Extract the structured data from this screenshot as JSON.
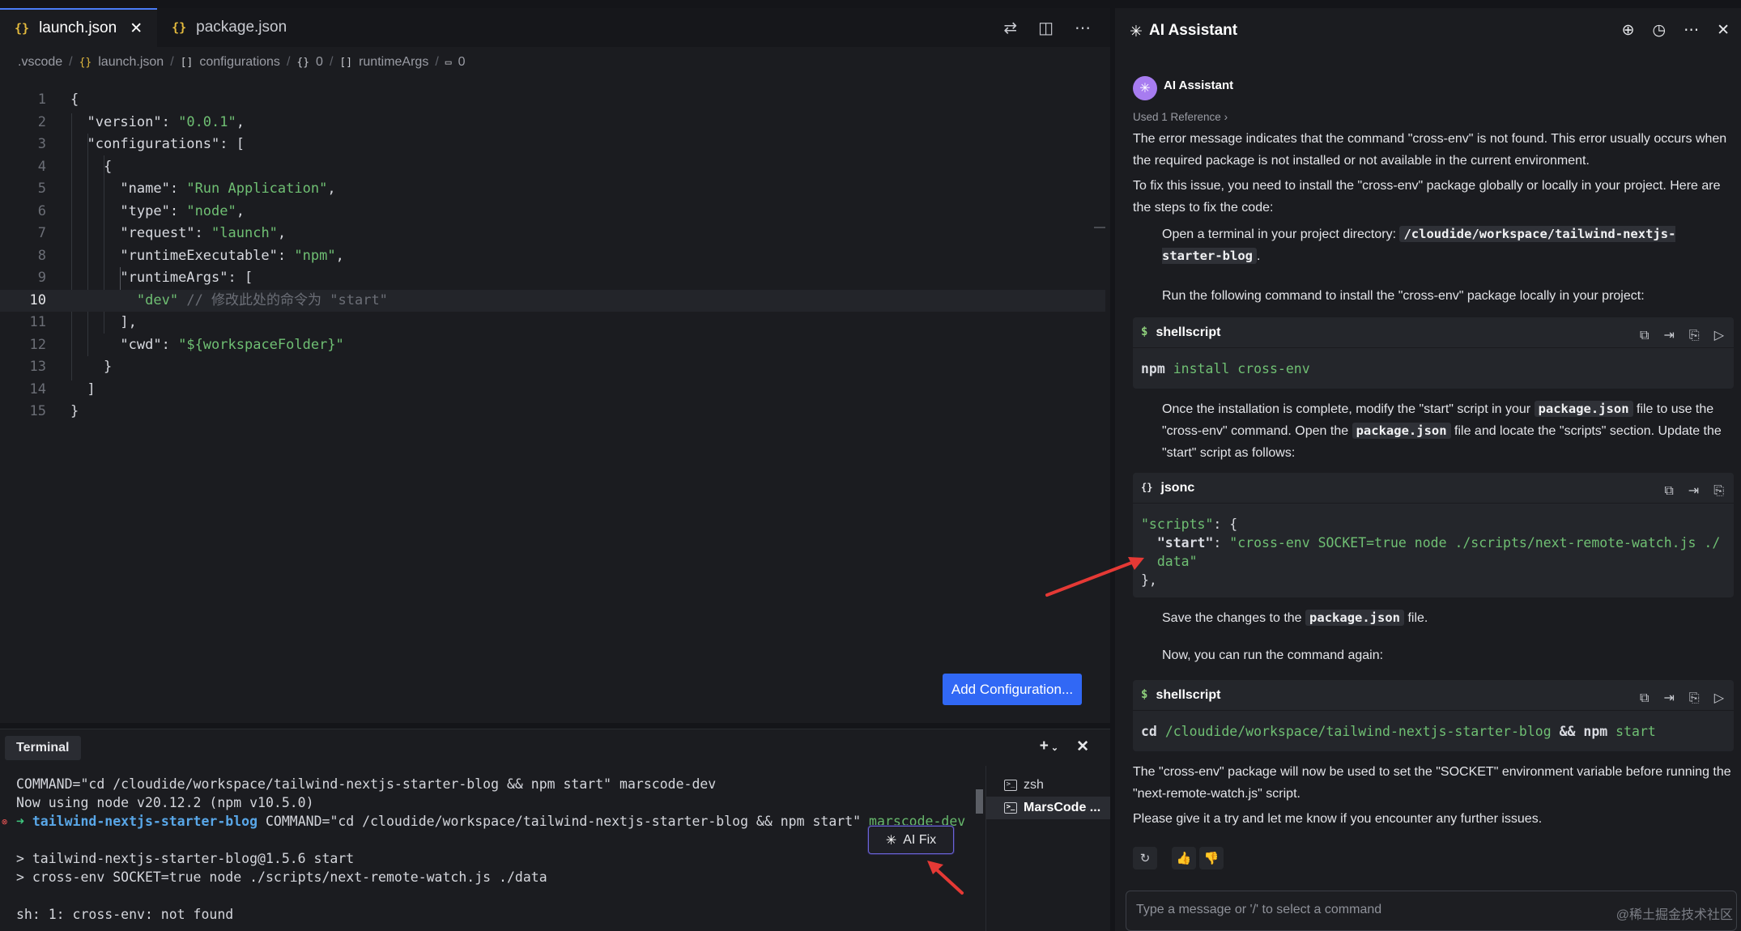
{
  "editor": {
    "tabs": [
      {
        "label": "launch.json",
        "active": true
      },
      {
        "label": "package.json",
        "active": false
      }
    ],
    "breadcrumb": [
      ".vscode",
      "launch.json",
      "configurations",
      "0",
      "runtimeArgs",
      "0"
    ],
    "lines": [
      {
        "n": "1"
      },
      {
        "n": "2"
      },
      {
        "n": "3"
      },
      {
        "n": "4"
      },
      {
        "n": "5"
      },
      {
        "n": "6"
      },
      {
        "n": "7"
      },
      {
        "n": "8"
      },
      {
        "n": "9"
      },
      {
        "n": "10"
      },
      {
        "n": "11"
      },
      {
        "n": "12"
      },
      {
        "n": "13"
      },
      {
        "n": "14"
      },
      {
        "n": "15"
      }
    ],
    "code": {
      "l1": "{",
      "l2_key": "\"version\"",
      "l2_val": "\"0.0.1\"",
      "l3_key": "\"configurations\"",
      "l3_rest": ": [",
      "l4": "{",
      "l5_key": "\"name\"",
      "l5_val": "\"Run Application\"",
      "l6_key": "\"type\"",
      "l6_val": "\"node\"",
      "l7_key": "\"request\"",
      "l7_val": "\"launch\"",
      "l8_key": "\"runtimeExecutable\"",
      "l8_val": "\"npm\"",
      "l9_key": "\"runtimeArgs\"",
      "l9_rest": ": [",
      "l10_val": "\"dev\"",
      "l10_comment": "// 修改此处的命令为 \"start\"",
      "l11": "],",
      "l12_key": "\"cwd\"",
      "l12_val": "\"${workspaceFolder}\"",
      "l13": "}",
      "l14": "]",
      "l15": "}"
    },
    "add_config_label": "Add Configuration..."
  },
  "terminal": {
    "tab_label": "Terminal",
    "line1": "COMMAND=\"cd /cloudide/workspace/tailwind-nextjs-starter-blog && npm start\" marscode-dev",
    "line2": "Now using node v20.12.2 (npm v10.5.0)",
    "line3_arrow": "➜",
    "line3_dir": "tailwind-nextjs-starter-blog",
    "line3_cmd": "COMMAND=\"cd /cloudide/workspace/tailwind-nextjs-starter-blog && npm start\"",
    "line3_host": "marscode-dev",
    "line4": "> tailwind-nextjs-starter-blog@1.5.6 start",
    "line5": "> cross-env SOCKET=true node ./scripts/next-remote-watch.js ./data",
    "line6": "sh: 1: cross-env: not found",
    "ai_fix_label": "AI Fix",
    "sessions": [
      {
        "label": "zsh",
        "selected": false
      },
      {
        "label": "MarsCode ...",
        "selected": true
      }
    ]
  },
  "assistant": {
    "title": "AI Assistant",
    "sender": "AI Assistant",
    "reference": "Used 1 Reference",
    "p1": "The error message indicates that the command \"cross-env\" is not found. This error usually occurs when the required package is not installed or not available in the current environment.",
    "p2": "To fix this issue, you need to install the \"cross-env\" package globally or locally in your project. Here are the steps to fix the code:",
    "step1_text": "Open a terminal in your project directory:",
    "step1_code": "/cloudide/workspace/tailwind-nextjs-starter-blog",
    "step2_text": "Run the following command to install the \"cross-env\" package locally in your project:",
    "block1": {
      "lang": "shellscript",
      "code_kw": "npm",
      "code_rest": "install cross-env"
    },
    "step3_a": "Once the installation is complete, modify the \"start\" script in your",
    "step3_code1": "package.json",
    "step3_b": "file to use the \"cross-env\" command. Open the",
    "step3_code2": "package.json",
    "step3_c": "file and locate the \"scripts\" section. Update the \"start\" script as follows:",
    "block2": {
      "lang": "jsonc",
      "l1_key": "\"scripts\"",
      "l1_rest": ": {",
      "l2_key": "\"start\"",
      "l2_val": "\"cross-env SOCKET=true node ./scripts/next-remote-watch.js ./",
      "l3_val": "data\"",
      "l4": "},"
    },
    "step4_a": "Save the changes to the",
    "step4_code": "package.json",
    "step4_b": "file.",
    "step5": "Now, you can run the command again:",
    "block3": {
      "lang": "shellscript",
      "code_kw1": "cd",
      "code_path": "/cloudide/workspace/tailwind-nextjs-starter-blog",
      "code_amp": "&&",
      "code_kw2": "npm",
      "code_rest": "start"
    },
    "p3": "The \"cross-env\" package will now be used to set the \"SOCKET\" environment variable before running the \"next-remote-watch.js\" script.",
    "p4": "Please give it a try and let me know if you encounter any further issues.",
    "input_placeholder": "Type a message or '/' to select a command"
  },
  "watermark": "@稀土掘金技术社区",
  "colors": {
    "accent": "#3168f5",
    "string": "#6fbf73",
    "arrow": "#e53935",
    "ai_fix_border": "#6b64d8"
  }
}
